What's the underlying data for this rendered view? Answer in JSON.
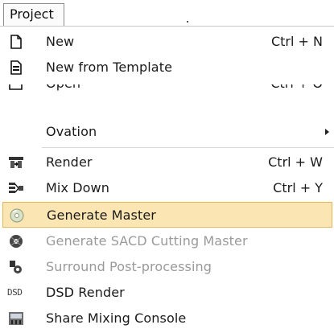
{
  "menubar": {
    "project_label": "Project"
  },
  "menu": {
    "items": [
      {
        "label": "New",
        "shortcut": "Ctrl + N",
        "icon": "new-document-icon"
      },
      {
        "label": "New from Template",
        "shortcut": "",
        "icon": "template-icon"
      },
      {
        "label": "Open",
        "shortcut": "Ctrl + O",
        "icon": "open-folder-icon"
      },
      {
        "label": "Ovation",
        "shortcut": "",
        "submenu": true
      },
      {
        "label": "Render",
        "shortcut": "Ctrl + W",
        "icon": "render-icon"
      },
      {
        "label": "Mix Down",
        "shortcut": "Ctrl + Y",
        "icon": "mix-down-icon"
      },
      {
        "label": "Generate Master",
        "shortcut": "",
        "icon": "disc-icon",
        "highlighted": true
      },
      {
        "label": "Generate SACD Cutting Master",
        "shortcut": "",
        "icon": "sacd-icon",
        "disabled": true
      },
      {
        "label": "Surround Post-processing",
        "shortcut": "",
        "icon": "surround-icon",
        "disabled": true
      },
      {
        "label": "DSD Render",
        "shortcut": "",
        "icon": "dsd-icon",
        "icon_text": "DSD"
      },
      {
        "label": "Share Mixing Console",
        "shortcut": "",
        "icon": "mixing-console-icon"
      }
    ]
  },
  "colors": {
    "highlight_bg": "#fbe6b3",
    "highlight_border": "#e3b95a",
    "disabled_text": "#9a9a9a"
  }
}
